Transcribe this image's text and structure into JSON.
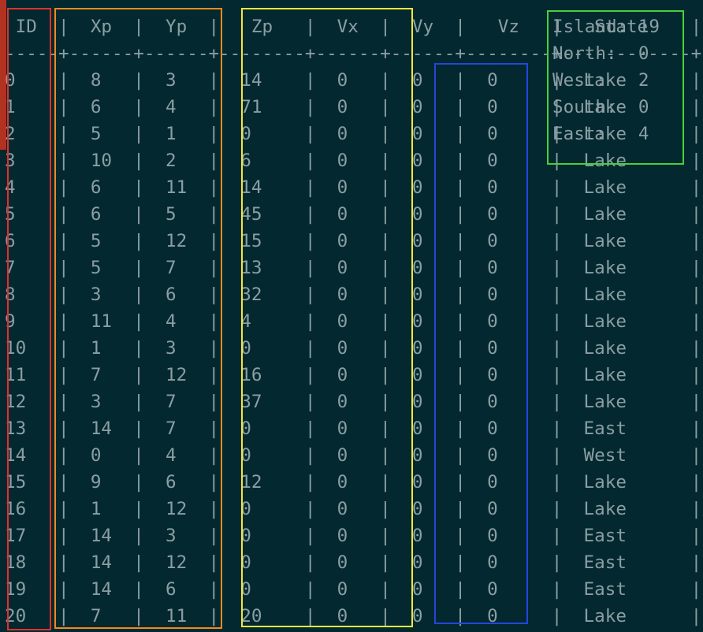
{
  "header": {
    "text": " ID  |  Xp  |  Yp  |   Zp   |  Vx  |  Vy  |   Vz   |   State    |",
    "separator": "-----+------+------+--------+------+------+--------+------------+"
  },
  "rows": [
    "0    |  8   |  3   |  14    |  0   |  0   |  0     |  Lake      |",
    "1    |  6   |  4   |  71    |  0   |  0   |  0     |  Lake      |",
    "2    |  5   |  1   |  0     |  0   |  0   |  0     |  Lake      |",
    "3    |  10  |  2   |  6     |  0   |  0   |  0     |  Lake      |",
    "4    |  6   |  11  |  14    |  0   |  0   |  0     |  Lake      |",
    "5    |  6   |  5   |  45    |  0   |  0   |  0     |  Lake      |",
    "6    |  5   |  12  |  15    |  0   |  0   |  0     |  Lake      |",
    "7    |  5   |  7   |  13    |  0   |  0   |  0     |  Lake      |",
    "8    |  3   |  6   |  32    |  0   |  0   |  0     |  Lake      |",
    "9    |  11  |  4   |  4     |  0   |  0   |  0     |  Lake      |",
    "10   |  1   |  3   |  0     |  0   |  0   |  0     |  Lake      |",
    "11   |  7   |  12  |  16    |  0   |  0   |  0     |  Lake      |",
    "12   |  3   |  7   |  37    |  0   |  0   |  0     |  Lake      |",
    "13   |  14  |  7   |  0     |  0   |  0   |  0     |  East      |",
    "14   |  0   |  4   |  0     |  0   |  0   |  0     |  West      |",
    "15   |  9   |  6   |  12    |  0   |  0   |  0     |  Lake      |",
    "16   |  1   |  12  |  0     |  0   |  0   |  0     |  Lake      |",
    "17   |  14  |  3   |  0     |  0   |  0   |  0     |  East      |",
    "18   |  14  |  12  |  0     |  0   |  0   |  0     |  East      |",
    "19   |  14  |  6   |  0     |  0   |  0   |  0     |  East      |",
    "20   |  7   |  11  |  20    |  0   |  0   |  0     |  Lake      |"
  ],
  "stats": [
    "Island: 19",
    "North:  0",
    "West:   2",
    "South:  0",
    "East:   4"
  ],
  "colors": {
    "background": "#03282f",
    "text": "#8a9ea3",
    "id_box": "#e0312b",
    "position_box": "#ee8a1f",
    "velocity_box": "#f2e640",
    "state_box": "#2346e0",
    "stats_box": "#45d23a"
  }
}
